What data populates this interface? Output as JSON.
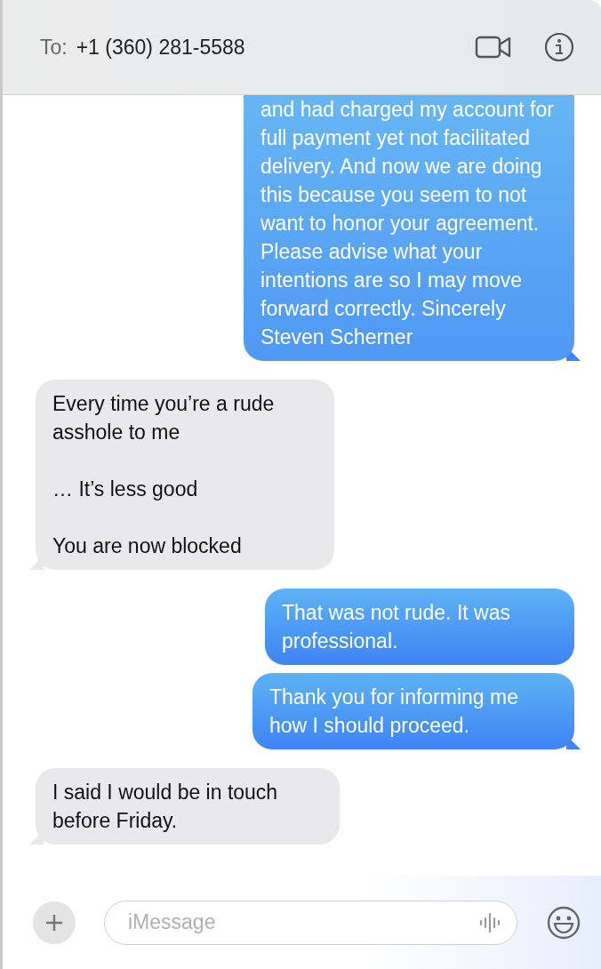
{
  "header": {
    "to_label": "To:",
    "recipient": "+1 (360) 281-5588"
  },
  "messages": [
    {
      "kind": "sent",
      "text": "and had charged my account for full payment yet not facilitated delivery. And now we are doing this because you seem to not want to honor your agreement. Please advise what your intentions are so I may move forward correctly. Sincerely Steven Scherner",
      "tail": true,
      "cut_top": true
    },
    {
      "kind": "received",
      "text": "Every time you’re a rude asshole to me\n\n… It’s less good\n\nYou are now blocked",
      "tail": true,
      "cut_top": false
    },
    {
      "kind": "sent",
      "text": "That was not rude. It was professional.",
      "tail": false,
      "cut_top": false
    },
    {
      "kind": "sent",
      "text": "Thank you for informing me how I should proceed.",
      "tail": true,
      "cut_top": false
    },
    {
      "kind": "received",
      "text": "I said I would be in touch before Friday.",
      "tail": true,
      "cut_top": false
    }
  ],
  "composer": {
    "placeholder": "iMessage"
  }
}
